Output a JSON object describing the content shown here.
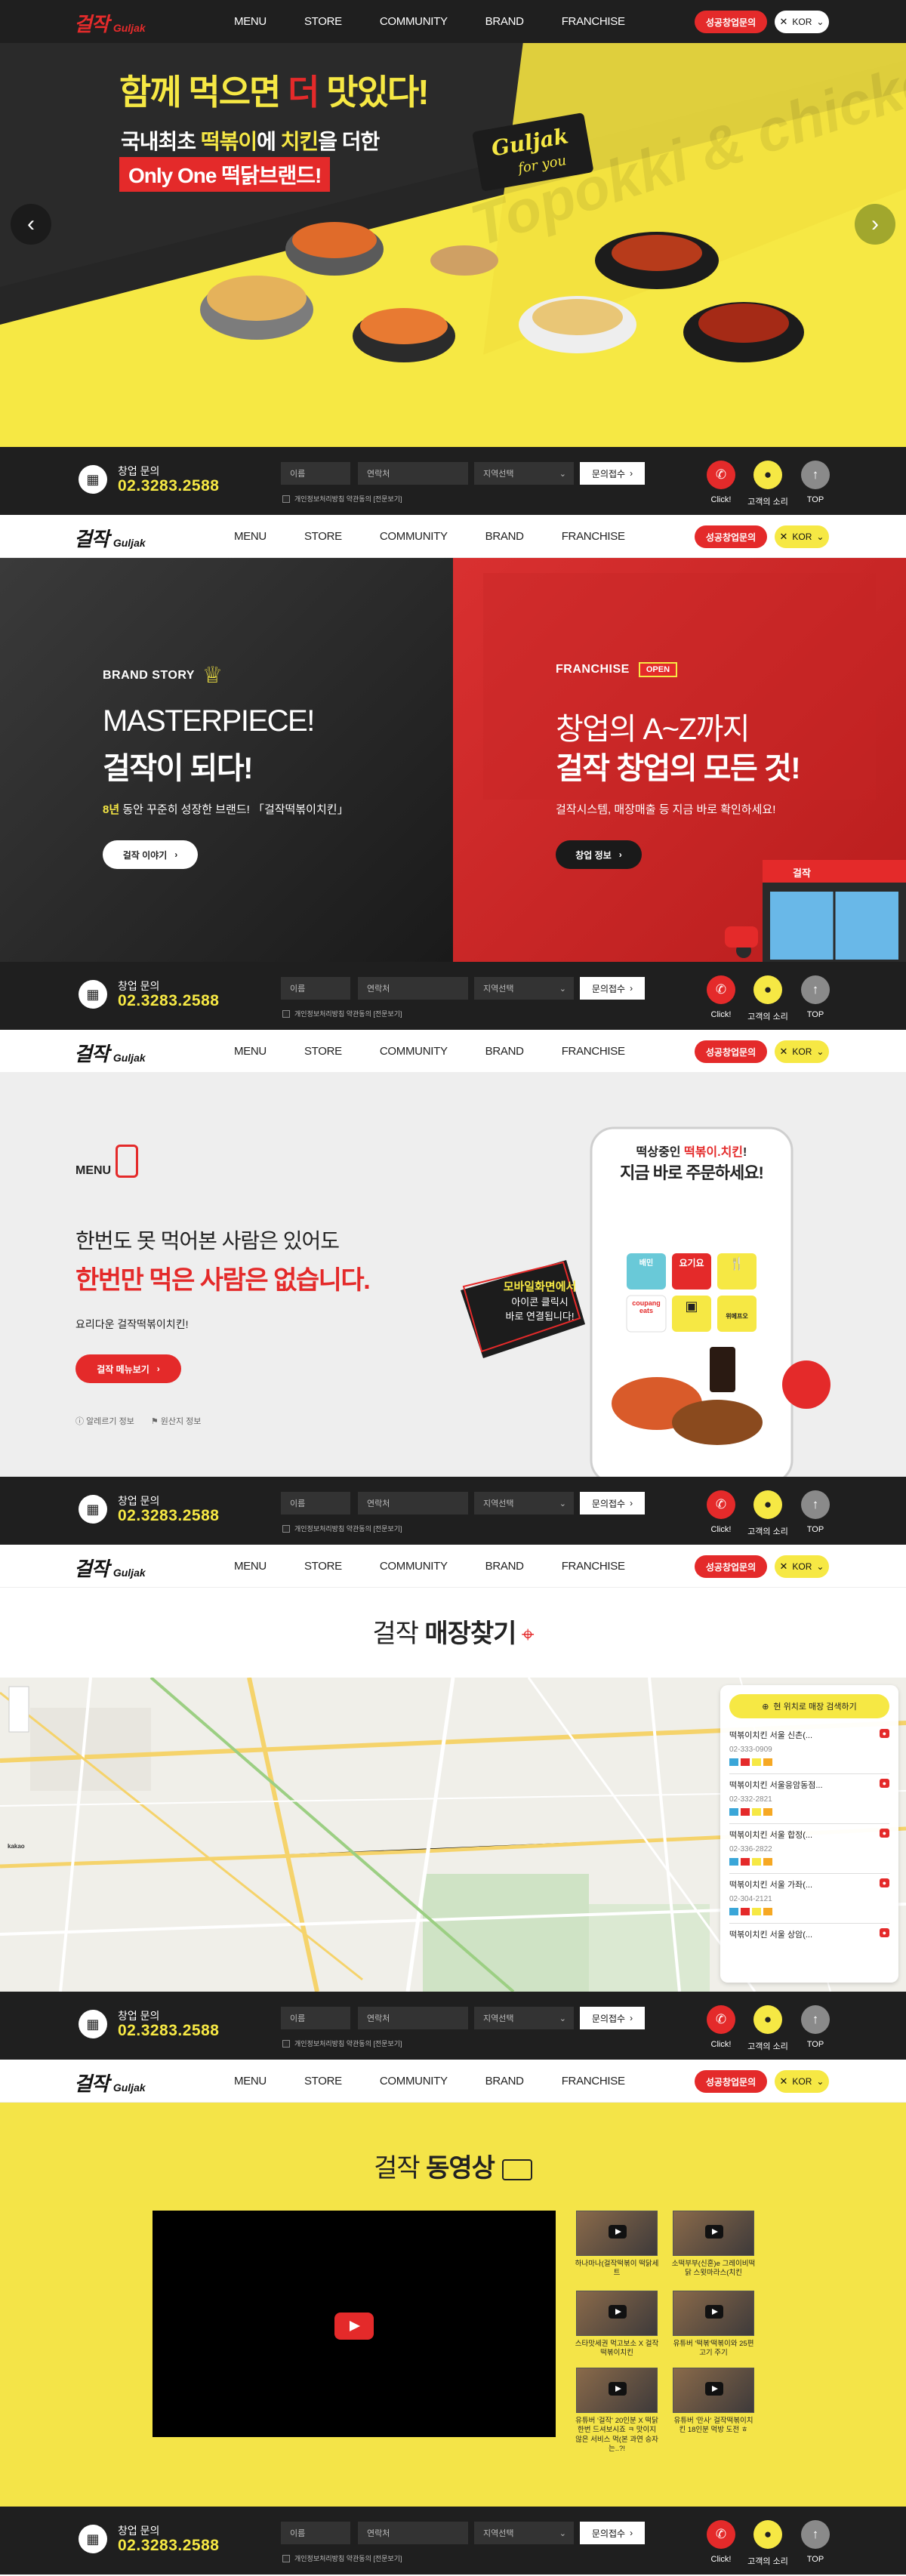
{
  "nav": {
    "logo_ko": "걸작",
    "logo_en": "Guljak",
    "menu": [
      "MENU",
      "STORE",
      "COMMUNITY",
      "BRAND",
      "FRANCHISE"
    ],
    "inquiry": "성공창업문의",
    "lang": "KOR"
  },
  "contact_bar": {
    "label": "창업 문의",
    "phone": "02.3283.2588",
    "name_placeholder": "이름",
    "contact_placeholder": "연락처",
    "region_placeholder": "지역선택",
    "submit": "문의접수",
    "agree": "개인정보처리방침 약관동의 [전문보기]",
    "quick": [
      {
        "label": "Click!"
      },
      {
        "label": "고객의 소리"
      },
      {
        "label": "TOP"
      }
    ]
  },
  "hero": {
    "headline_a": "함께 먹으면 ",
    "headline_b": "더",
    "headline_c": " 맛있다!",
    "sub_a": "국내최초 ",
    "sub_b": "떡볶이",
    "sub_c": "에 ",
    "sub_d": "치킨",
    "sub_e": "을 더한",
    "highlight": "Only One 떡닭브랜드!",
    "badge_line1": "Guljak",
    "badge_line2": "for you",
    "watermark": "Topokki & chicken"
  },
  "brand": {
    "tag": "BRAND STORY",
    "title1": "MASTERPIECE!",
    "title2": "걸작이 되다!",
    "desc_a": "8년",
    "desc_b": " 동안 꾸준히 성장한 브랜드! 「걸작떡볶이치킨」",
    "button": "걸작 이야기"
  },
  "franchise": {
    "tag": "FRANCHISE",
    "open": "OPEN",
    "title1": "창업의 A~Z까지",
    "title2": "걸작 창업의 모든 것!",
    "desc": "걸작시스템, 매장매출 등 지금 바로 확인하세요!",
    "button": "창업 정보",
    "store_sign": "걸작"
  },
  "menu_section": {
    "tag": "MENU",
    "line1": "한번도 못 먹어본 사람은 있어도",
    "line2": "한번만 먹은 사람은 없습니다.",
    "desc": "요리다운 걸작떡볶이치킨!",
    "button": "걸작 메뉴보기",
    "link1": "알레르기 정보",
    "link2": "원산지 정보",
    "phone_line1_a": "떡상중인 ",
    "phone_line1_b": "떡볶이.치킨",
    "phone_line1_c": "!",
    "phone_line2": "지금 바로 주문하세요!",
    "apps": [
      "배민",
      "요기요",
      "",
      "coupang eats",
      "",
      "위메프오"
    ],
    "callout": [
      "모바일화면에서",
      "아이콘 클릭시",
      "바로 연결됩니다!"
    ]
  },
  "store": {
    "title_a": "걸작 ",
    "title_b": "매장찾기",
    "locate": "현 위치로 매장 검색하기",
    "stores": [
      {
        "name": "떡볶이치킨 서울 신촌(...",
        "tel": "02-333-0909"
      },
      {
        "name": "떡볶이치킨 서울응암동점...",
        "tel": "02-332-2821"
      },
      {
        "name": "떡볶이치킨 서울 합정(...",
        "tel": "02-336-2822"
      },
      {
        "name": "떡볶이치킨 서울 가좌(...",
        "tel": "02-304-2121"
      },
      {
        "name": "떡볶이치킨 서울 상암(...",
        "tel": ""
      }
    ],
    "kakao": "kakao"
  },
  "video": {
    "title_a": "걸작 ",
    "title_b": "동영상",
    "items": [
      {
        "caption": "하나마나(걸작떡볶이 떡닭세트"
      },
      {
        "caption": "소떡부부(신혼)e 그레이비떡닭 스윗마라스(치킨"
      },
      {
        "caption": "스타맛세권 먹고보소 X 걸작떡볶이치킨"
      },
      {
        "caption": "유튜버 '떡볶'떡볶이와 25편 고기 주기"
      },
      {
        "caption": "유튜버 '걸작' 20인분 X 떡닭 한번 드셔보시죠 ㅋ 맛이지 않은 서비스 먹(본 과연 승자는..?!"
      },
      {
        "caption": "유튜버 '만사' 걸작떡볶이치킨 18인분 먹방 도전 ㅎ"
      }
    ]
  }
}
